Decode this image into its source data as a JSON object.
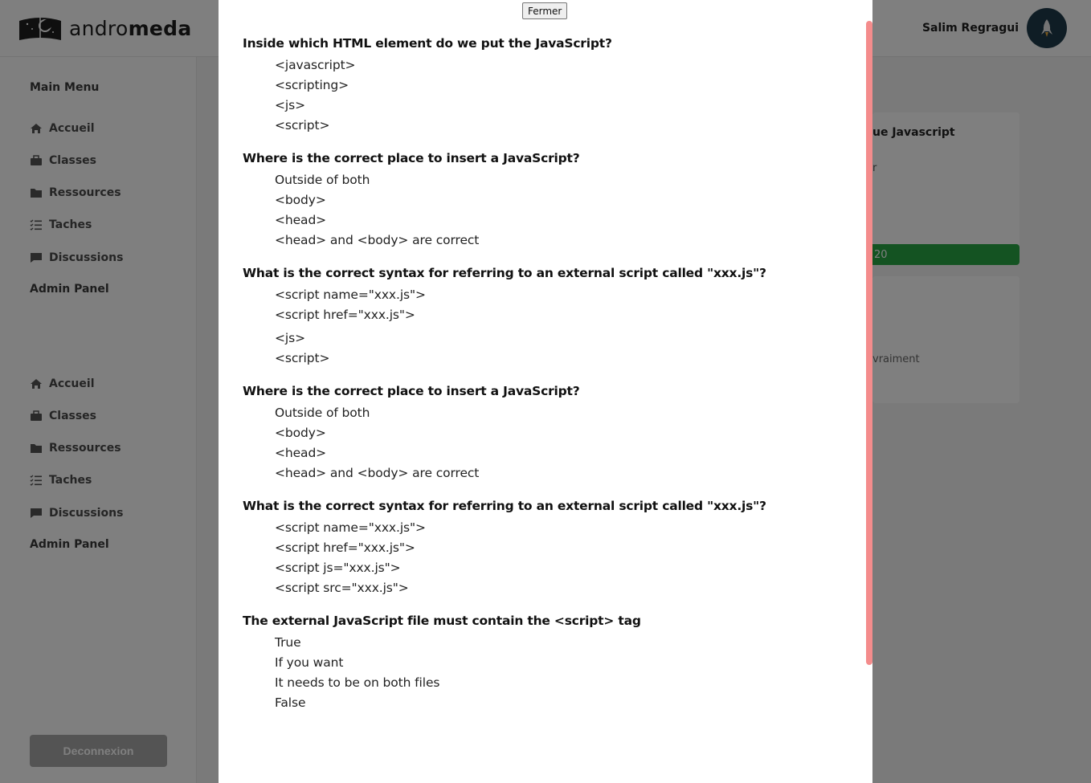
{
  "app": {
    "logo_light": "andro",
    "logo_bold": "meda"
  },
  "user": {
    "name": "Salim Regragui"
  },
  "sidebar": {
    "main_menu_title": "Main Menu",
    "items": [
      {
        "label": "Accueil",
        "icon": "home-icon"
      },
      {
        "label": "Classes",
        "icon": "briefcase-icon"
      },
      {
        "label": "Ressources",
        "icon": "folder-icon"
      },
      {
        "label": "Taches",
        "icon": "task-list-icon"
      },
      {
        "label": "Discussions",
        "icon": "chat-icon"
      }
    ],
    "admin_panel": "Admin Panel",
    "items2": [
      {
        "label": "Accueil",
        "icon": "home-icon"
      },
      {
        "label": "Classes",
        "icon": "briefcase-icon"
      },
      {
        "label": "Ressources",
        "icon": "folder-icon"
      },
      {
        "label": "Taches",
        "icon": "task-list-icon"
      },
      {
        "label": "Discussions",
        "icon": "chat-icon"
      }
    ],
    "admin_panel2": "Admin Panel",
    "logout": "Deconnexion"
  },
  "cards": {
    "card1": {
      "title": "ue Javascript",
      "sub": "r",
      "bar": "20"
    },
    "card2": {
      "text": "vraiment"
    }
  },
  "modal": {
    "close_label": "Fermer",
    "questions": [
      {
        "question": "Inside which HTML element do we put the JavaScript?",
        "answers": [
          "<javascript>",
          "<scripting>",
          "<js>",
          "<script>"
        ]
      },
      {
        "question": "Where is the correct place to insert a JavaScript?",
        "answers": [
          "Outside of both",
          "<body>",
          "<head>",
          "<head> and <body> are correct"
        ]
      },
      {
        "question": "What is the correct syntax for referring to an external script called \"xxx.js\"?",
        "answers": [
          "<script name=\"xxx.js\">",
          "<script href=\"xxx.js\">",
          "<js>",
          "<script>"
        ]
      },
      {
        "question": "Where is the correct place to insert a JavaScript?",
        "answers": [
          "Outside of both",
          "<body>",
          "<head>",
          "<head> and <body> are correct"
        ]
      },
      {
        "question": "What is the correct syntax for referring to an external script called \"xxx.js\"?",
        "answers": [
          "<script name=\"xxx.js\">",
          "<script href=\"xxx.js\">",
          "<script js=\"xxx.js\">",
          "<script src=\"xxx.js\">"
        ]
      },
      {
        "question": "The external JavaScript file must contain the <script> tag",
        "answers": [
          "True",
          "If you want",
          "It needs to be on both files",
          "False"
        ]
      }
    ]
  },
  "colors": {
    "overlay": "#000000",
    "progress": "#28a745",
    "scrollbar": "#f48c8c",
    "avatar_bg": "#1f3b4a"
  }
}
